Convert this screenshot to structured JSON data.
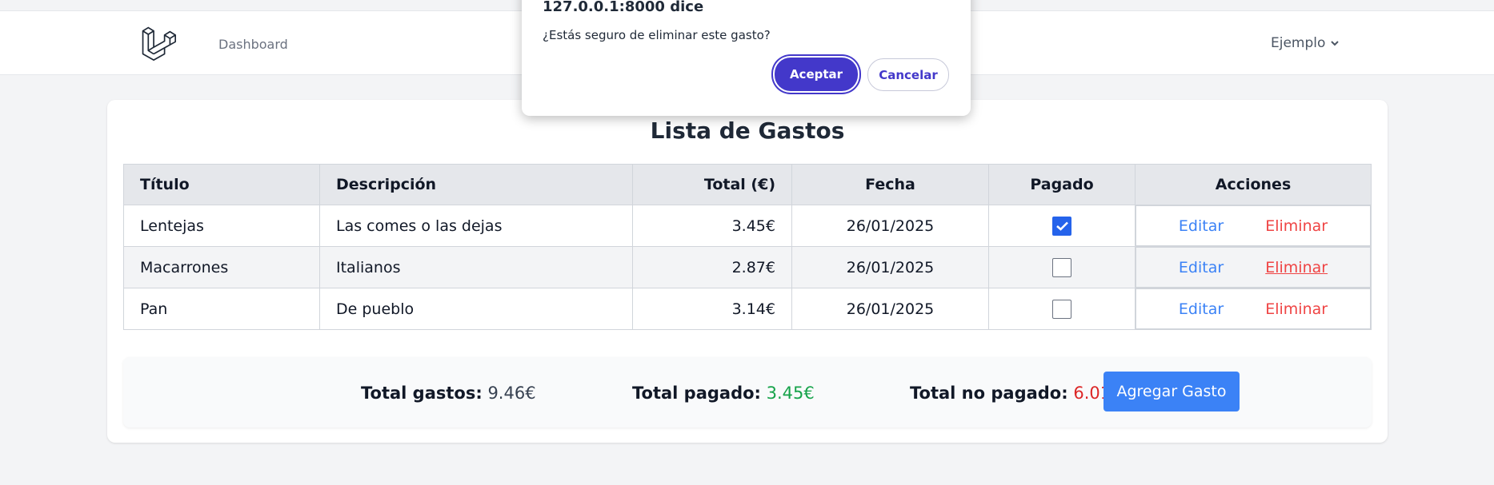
{
  "nav": {
    "dashboard_label": "Dashboard",
    "user_name": "Ejemplo"
  },
  "card": {
    "title": "Lista de Gastos"
  },
  "table": {
    "headers": [
      "Título",
      "Descripción",
      "Total (€)",
      "Fecha",
      "Pagado",
      "Acciones"
    ],
    "rows": [
      {
        "titulo": "Lentejas",
        "descripcion": "Las comes o las dejas",
        "total": "3.45€",
        "fecha": "26/01/2025",
        "pagado": true,
        "edit": "Editar",
        "delete": "Eliminar"
      },
      {
        "titulo": "Macarrones",
        "descripcion": "Italianos",
        "total": "2.87€",
        "fecha": "26/01/2025",
        "pagado": false,
        "edit": "Editar",
        "delete": "Eliminar"
      },
      {
        "titulo": "Pan",
        "descripcion": "De pueblo",
        "total": "3.14€",
        "fecha": "26/01/2025",
        "pagado": false,
        "edit": "Editar",
        "delete": "Eliminar"
      }
    ]
  },
  "summary": {
    "total_gastos_label": "Total gastos:",
    "total_gastos_value": "9.46€",
    "total_pagado_label": "Total pagado:",
    "total_pagado_value": "3.45€",
    "total_no_pagado_label": "Total no pagado:",
    "total_no_pagado_value": "6.01€",
    "add_button": "Agregar Gasto"
  },
  "dialog": {
    "title": "127.0.0.1:8000 dice",
    "message": "¿Estás seguro de eliminar este gasto?",
    "ok_label": "Aceptar",
    "cancel_label": "Cancelar"
  },
  "colors": {
    "accent": "#3b82f6",
    "danger": "#ef4444",
    "success": "#16a34a",
    "dialog_primary": "#4338ca"
  }
}
